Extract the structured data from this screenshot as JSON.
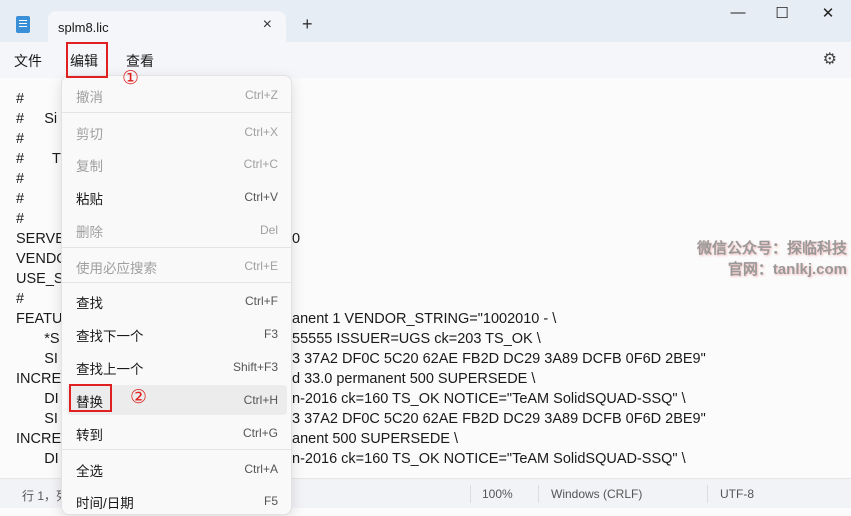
{
  "window": {
    "tab_title": "splm8.lic",
    "tab_close": "×",
    "new_tab": "+",
    "minimize": "—",
    "maximize": "☐",
    "close": "✕"
  },
  "menubar": {
    "file": "文件",
    "edit": "编辑",
    "view": "查看",
    "settings_icon": "⚙"
  },
  "annotations": {
    "step1": "①",
    "step2": "②"
  },
  "edit_menu": [
    {
      "label": "撤消",
      "shortcut": "Ctrl+Z",
      "disabled": true
    },
    {
      "label": "剪切",
      "shortcut": "Ctrl+X",
      "disabled": true
    },
    {
      "label": "复制",
      "shortcut": "Ctrl+C",
      "disabled": true
    },
    {
      "label": "粘贴",
      "shortcut": "Ctrl+V",
      "disabled": false
    },
    {
      "label": "删除",
      "shortcut": "Del",
      "disabled": true
    },
    {
      "label": "使用必应搜索",
      "shortcut": "Ctrl+E",
      "disabled": true
    },
    {
      "label": "查找",
      "shortcut": "Ctrl+F",
      "disabled": false
    },
    {
      "label": "查找下一个",
      "shortcut": "F3",
      "disabled": false
    },
    {
      "label": "查找上一个",
      "shortcut": "Shift+F3",
      "disabled": false
    },
    {
      "label": "替换",
      "shortcut": "Ctrl+H",
      "disabled": false
    },
    {
      "label": "转到",
      "shortcut": "Ctrl+G",
      "disabled": false
    },
    {
      "label": "全选",
      "shortcut": "Ctrl+A",
      "disabled": false
    },
    {
      "label": "时间/日期",
      "shortcut": "F5",
      "disabled": false
    }
  ],
  "editor_lines": [
    {
      "left": "#",
      "right": ""
    },
    {
      "left": "#     Si",
      "right": ""
    },
    {
      "left": "#",
      "right": ""
    },
    {
      "left": "#       T",
      "right": ""
    },
    {
      "left": "#",
      "right": ""
    },
    {
      "left": "#",
      "right": ""
    },
    {
      "left": "#",
      "right": ""
    },
    {
      "left": "SERVE",
      "right": "0"
    },
    {
      "left": "VENDO",
      "right": ""
    },
    {
      "left": "USE_S",
      "right": ""
    },
    {
      "left": "#",
      "right": ""
    },
    {
      "left": "FEATU",
      "right": "anent 1 VENDOR_STRING=\"1002010 - \\"
    },
    {
      "left": "       *S",
      "right": "55555 ISSUER=UGS ck=203 TS_OK \\"
    },
    {
      "left": "       SI",
      "right": "3 37A2 DF0C 5C20 62AE FB2D DC29 3A89 DCFB 0F6D 2BE9\""
    },
    {
      "left": "INCRE",
      "right": "d 33.0 permanent 500 SUPERSEDE \\"
    },
    {
      "left": "       DI",
      "right": "n-2016 ck=160 TS_OK NOTICE=\"TeAM SolidSQUAD-SSQ\" \\"
    },
    {
      "left": "       SI",
      "right": "3 37A2 DF0C 5C20 62AE FB2D DC29 3A89 DCFB 0F6D 2BE9\""
    },
    {
      "left": "INCRE",
      "right": "anent 500 SUPERSEDE \\"
    },
    {
      "left": "       DI",
      "right": "n-2016 ck=160 TS_OK NOTICE=\"TeAM SolidSQUAD-SSQ\" \\"
    }
  ],
  "watermark": {
    "line1": "微信公众号：探临科技",
    "line2": "官网：tanlkj.com"
  },
  "status": {
    "position": "行 1，列",
    "zoom": "100%",
    "line_ending": "Windows (CRLF)",
    "encoding": "UTF-8"
  }
}
